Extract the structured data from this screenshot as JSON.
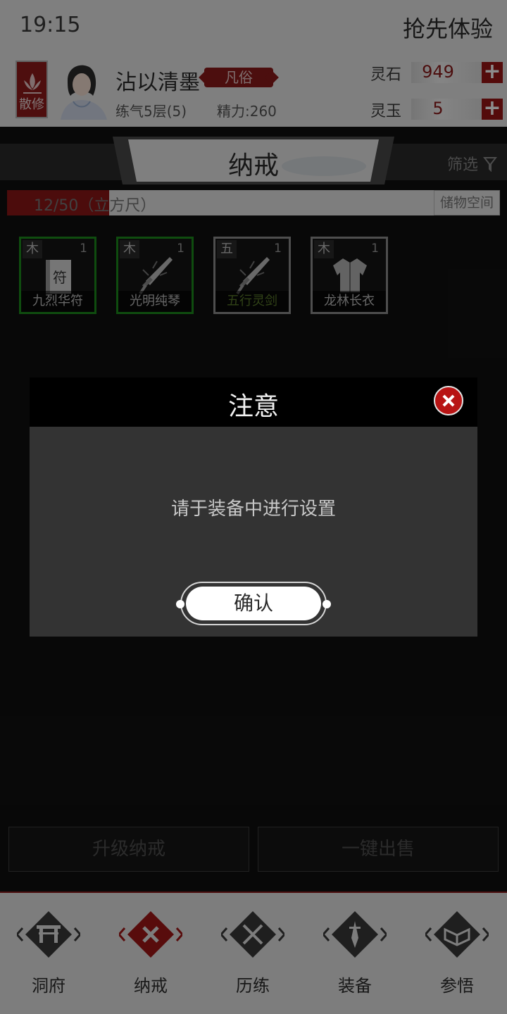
{
  "status": {
    "time": "19:15",
    "early_access": "抢先体验"
  },
  "profile": {
    "sect_badge": "散修",
    "name": "沾以清墨",
    "rank": "凡俗",
    "realm": "练气5层(5)",
    "energy": "精力:260",
    "spirit_stone": {
      "label": "灵石",
      "value": "949"
    },
    "spirit_jade": {
      "label": "灵玉",
      "value": "5"
    }
  },
  "tab": {
    "title": "纳戒",
    "filter": "筛选"
  },
  "capacity": {
    "text": "12/50（立方尺）",
    "used": 12,
    "total": 50,
    "storage_label": "储物空间"
  },
  "items": [
    {
      "element": "木",
      "count": "1",
      "name": "九烈华符",
      "icon": "talisman-icon"
    },
    {
      "element": "木",
      "count": "1",
      "name": "光明纯琴",
      "icon": "sword-icon"
    },
    {
      "element": "五",
      "count": "1",
      "name": "五行灵剑",
      "icon": "sword-icon"
    },
    {
      "element": "木",
      "count": "1",
      "name": "龙林长衣",
      "icon": "robe-icon"
    }
  ],
  "actions": {
    "upgrade": "升级纳戒",
    "sell_all": "一键出售"
  },
  "nav": [
    "洞府",
    "纳戒",
    "历练",
    "装备",
    "参悟"
  ],
  "dialog": {
    "title": "注意",
    "message": "请于装备中进行设置",
    "confirm": "确认"
  },
  "colors": {
    "accent_red": "#8b1a1a",
    "item_border_green": "#1d8a1d",
    "item_border_gray": "#8f8f8f"
  }
}
